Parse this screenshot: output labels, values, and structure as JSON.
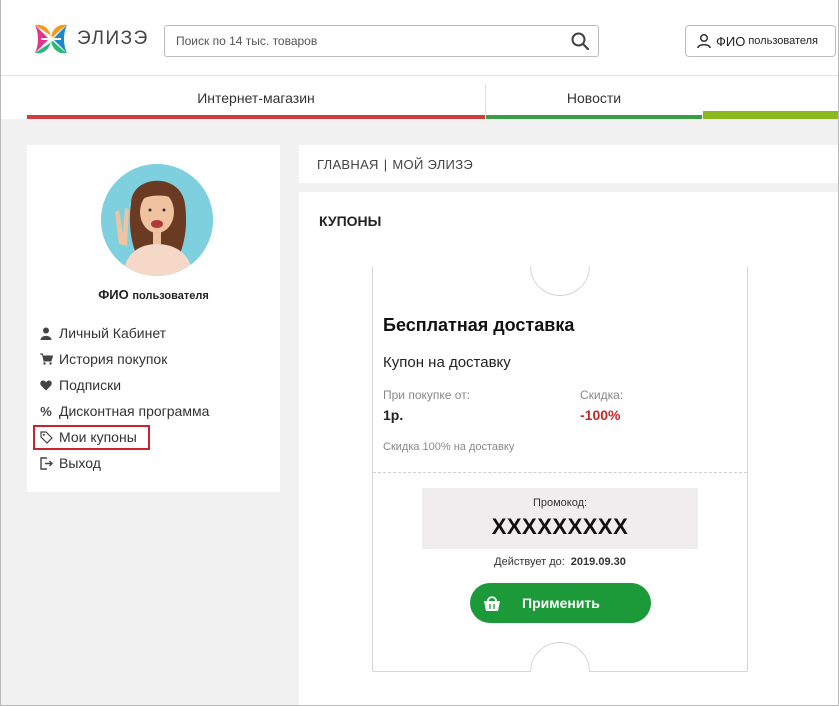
{
  "header": {
    "logo_text": "ЭЛИЗЭ",
    "search_placeholder": "Поиск по 14 тыс. товаров",
    "user_button": {
      "name": "ФИО",
      "suffix": "пользователя"
    }
  },
  "nav": {
    "tabs": [
      {
        "label": "Интернет-магазин",
        "color": "#d13c3c"
      },
      {
        "label": "Новости",
        "color": "#3a9c45"
      },
      {
        "label": "",
        "color": "#8ab81e"
      }
    ]
  },
  "sidebar": {
    "user_name": "ФИО",
    "user_name_suffix": "пользователя",
    "menu": [
      {
        "label": "Личный Кабинет",
        "icon": "user-icon"
      },
      {
        "label": "История покупок",
        "icon": "cart-icon"
      },
      {
        "label": "Подписки",
        "icon": "heart-icon"
      },
      {
        "label": "Дисконтная программа",
        "icon": "percent-icon"
      },
      {
        "label": "Мои купоны",
        "icon": "tag-icon",
        "active": true
      },
      {
        "label": "Выход",
        "icon": "logout-icon"
      }
    ]
  },
  "breadcrumb": {
    "home": "ГЛАВНАЯ",
    "separator": "|",
    "current": "МОЙ ЭЛИЗЭ"
  },
  "main": {
    "title": "КУПОНЫ",
    "coupon": {
      "title": "Бесплатная доставка",
      "subtitle": "Купон на доставку",
      "min_purchase_label": "При покупке от:",
      "min_purchase_value": "1р.",
      "discount_label": "Скидка:",
      "discount_value": "-100%",
      "note": "Скидка 100% на доставку",
      "promo_label": "Промокод:",
      "promo_code": "XXXXXXXXX",
      "valid_label": "Действует до:",
      "valid_date": "2019.09.30",
      "apply_label": "Применить"
    }
  },
  "colors": {
    "accent_green": "#1c9a3a",
    "accent_red": "#c62828",
    "highlight_border": "#c8252e"
  }
}
